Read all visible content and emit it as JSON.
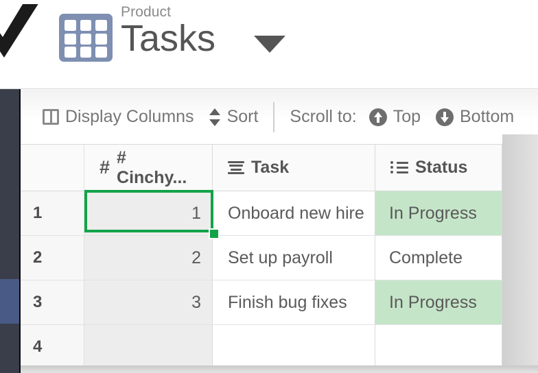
{
  "header": {
    "logo_icon": "cinchy-check-logo",
    "table_icon": "grid-table-icon",
    "eyebrow": "Product",
    "title": "Tasks",
    "dropdown_icon": "caret-down-icon"
  },
  "toolbar": {
    "display_columns": {
      "label": "Display Columns",
      "icon": "columns-icon"
    },
    "sort": {
      "label": "Sort",
      "icon": "sort-updown-icon"
    },
    "scroll_to_label": "Scroll to:",
    "scroll_top": {
      "label": "Top",
      "icon": "circle-arrow-up-icon"
    },
    "scroll_bottom": {
      "label": "Bottom",
      "icon": "circle-arrow-down-icon"
    }
  },
  "grid": {
    "columns": [
      {
        "key": "gutter",
        "label": "",
        "icon": ""
      },
      {
        "key": "id",
        "label": "# Cinchy...",
        "icon": "hash-icon"
      },
      {
        "key": "task",
        "label": "Task",
        "icon": "text-lines-icon"
      },
      {
        "key": "status",
        "label": "Status",
        "icon": "bullet-list-icon"
      }
    ],
    "rows": [
      {
        "num": "1",
        "id": "1",
        "task": "Onboard new hire",
        "status": "In Progress",
        "status_highlight": true
      },
      {
        "num": "2",
        "id": "2",
        "task": "Set up payroll",
        "status": "Complete",
        "status_highlight": false
      },
      {
        "num": "3",
        "id": "3",
        "task": "Finish bug fixes",
        "status": "In Progress",
        "status_highlight": true
      },
      {
        "num": "4",
        "id": "",
        "task": "",
        "status": "",
        "status_highlight": false
      }
    ],
    "selected_cell": {
      "row": "1",
      "column": "id",
      "value": "1"
    }
  },
  "colors": {
    "selection_green": "#12a349",
    "status_highlight_green": "#c5e5c8",
    "rail_dark": "#3a3e4a",
    "rail_active_blue": "#4a5a86",
    "table_icon_blue": "#7e8fb2"
  }
}
